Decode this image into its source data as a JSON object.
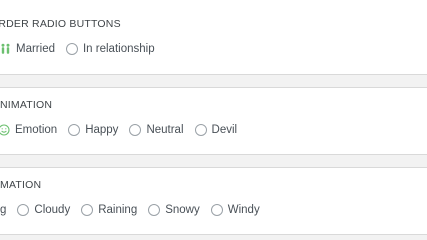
{
  "sections": [
    {
      "title": "ORDER RADIO BUTTONS",
      "options": [
        {
          "label": "Married",
          "icon": "people-icon",
          "checked": true
        },
        {
          "label": "In relationship",
          "checked": false
        }
      ]
    },
    {
      "title": "NIMATION",
      "options": [
        {
          "label": "Emotion",
          "icon": "smiley-icon",
          "checked": true
        },
        {
          "label": "Happy",
          "checked": false
        },
        {
          "label": "Neutral",
          "checked": false
        },
        {
          "label": "Devil",
          "checked": false
        }
      ]
    },
    {
      "title": "MATION",
      "options": [
        {
          "label": "g",
          "checked": true
        },
        {
          "label": "Cloudy",
          "checked": false
        },
        {
          "label": "Raining",
          "checked": false
        },
        {
          "label": "Snowy",
          "checked": false
        },
        {
          "label": "Windy",
          "checked": false
        }
      ]
    }
  ],
  "colors": {
    "accent": "#6cc070",
    "border": "#9aa1a7",
    "text": "#495057"
  }
}
